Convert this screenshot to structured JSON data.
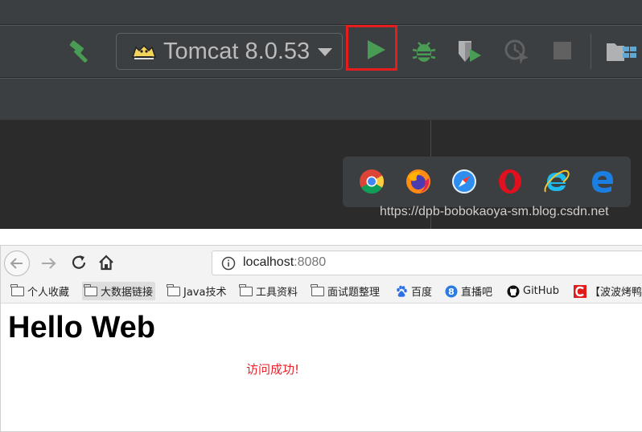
{
  "ide": {
    "run_configuration": "Tomcat 8.0.53",
    "toolbar_icons": [
      "hammer-icon",
      "tomcat-icon",
      "run-icon",
      "debug-icon",
      "coverage-icon",
      "profile-icon",
      "stop-icon",
      "project-structure-icon"
    ],
    "highlight_color": "#e41e1e",
    "browser_launchers": [
      "chrome-icon",
      "firefox-icon",
      "safari-icon",
      "opera-icon",
      "ie-icon",
      "edge-icon"
    ],
    "watermark": "https://dpb-bobokaoya-sm.blog.csdn.net"
  },
  "browser": {
    "url_host": "localhost",
    "url_port": ":8080",
    "bookmarks": [
      {
        "label": "个人收藏",
        "icon": "folder-icon"
      },
      {
        "label": "大数据链接",
        "icon": "folder-icon"
      },
      {
        "label": "Java技术",
        "icon": "folder-icon"
      },
      {
        "label": "工具资料",
        "icon": "folder-icon"
      },
      {
        "label": "面试题整理",
        "icon": "folder-icon"
      },
      {
        "label": "百度",
        "icon": "baidu-icon"
      },
      {
        "label": "直播吧",
        "icon": "zhibo8-icon"
      },
      {
        "label": "GitHub",
        "icon": "github-icon"
      },
      {
        "label": "【波波烤鸭",
        "icon": "csdn-icon"
      }
    ],
    "page": {
      "heading": "Hello Web",
      "message": "访问成功!",
      "message_color": "#e8212b"
    }
  }
}
